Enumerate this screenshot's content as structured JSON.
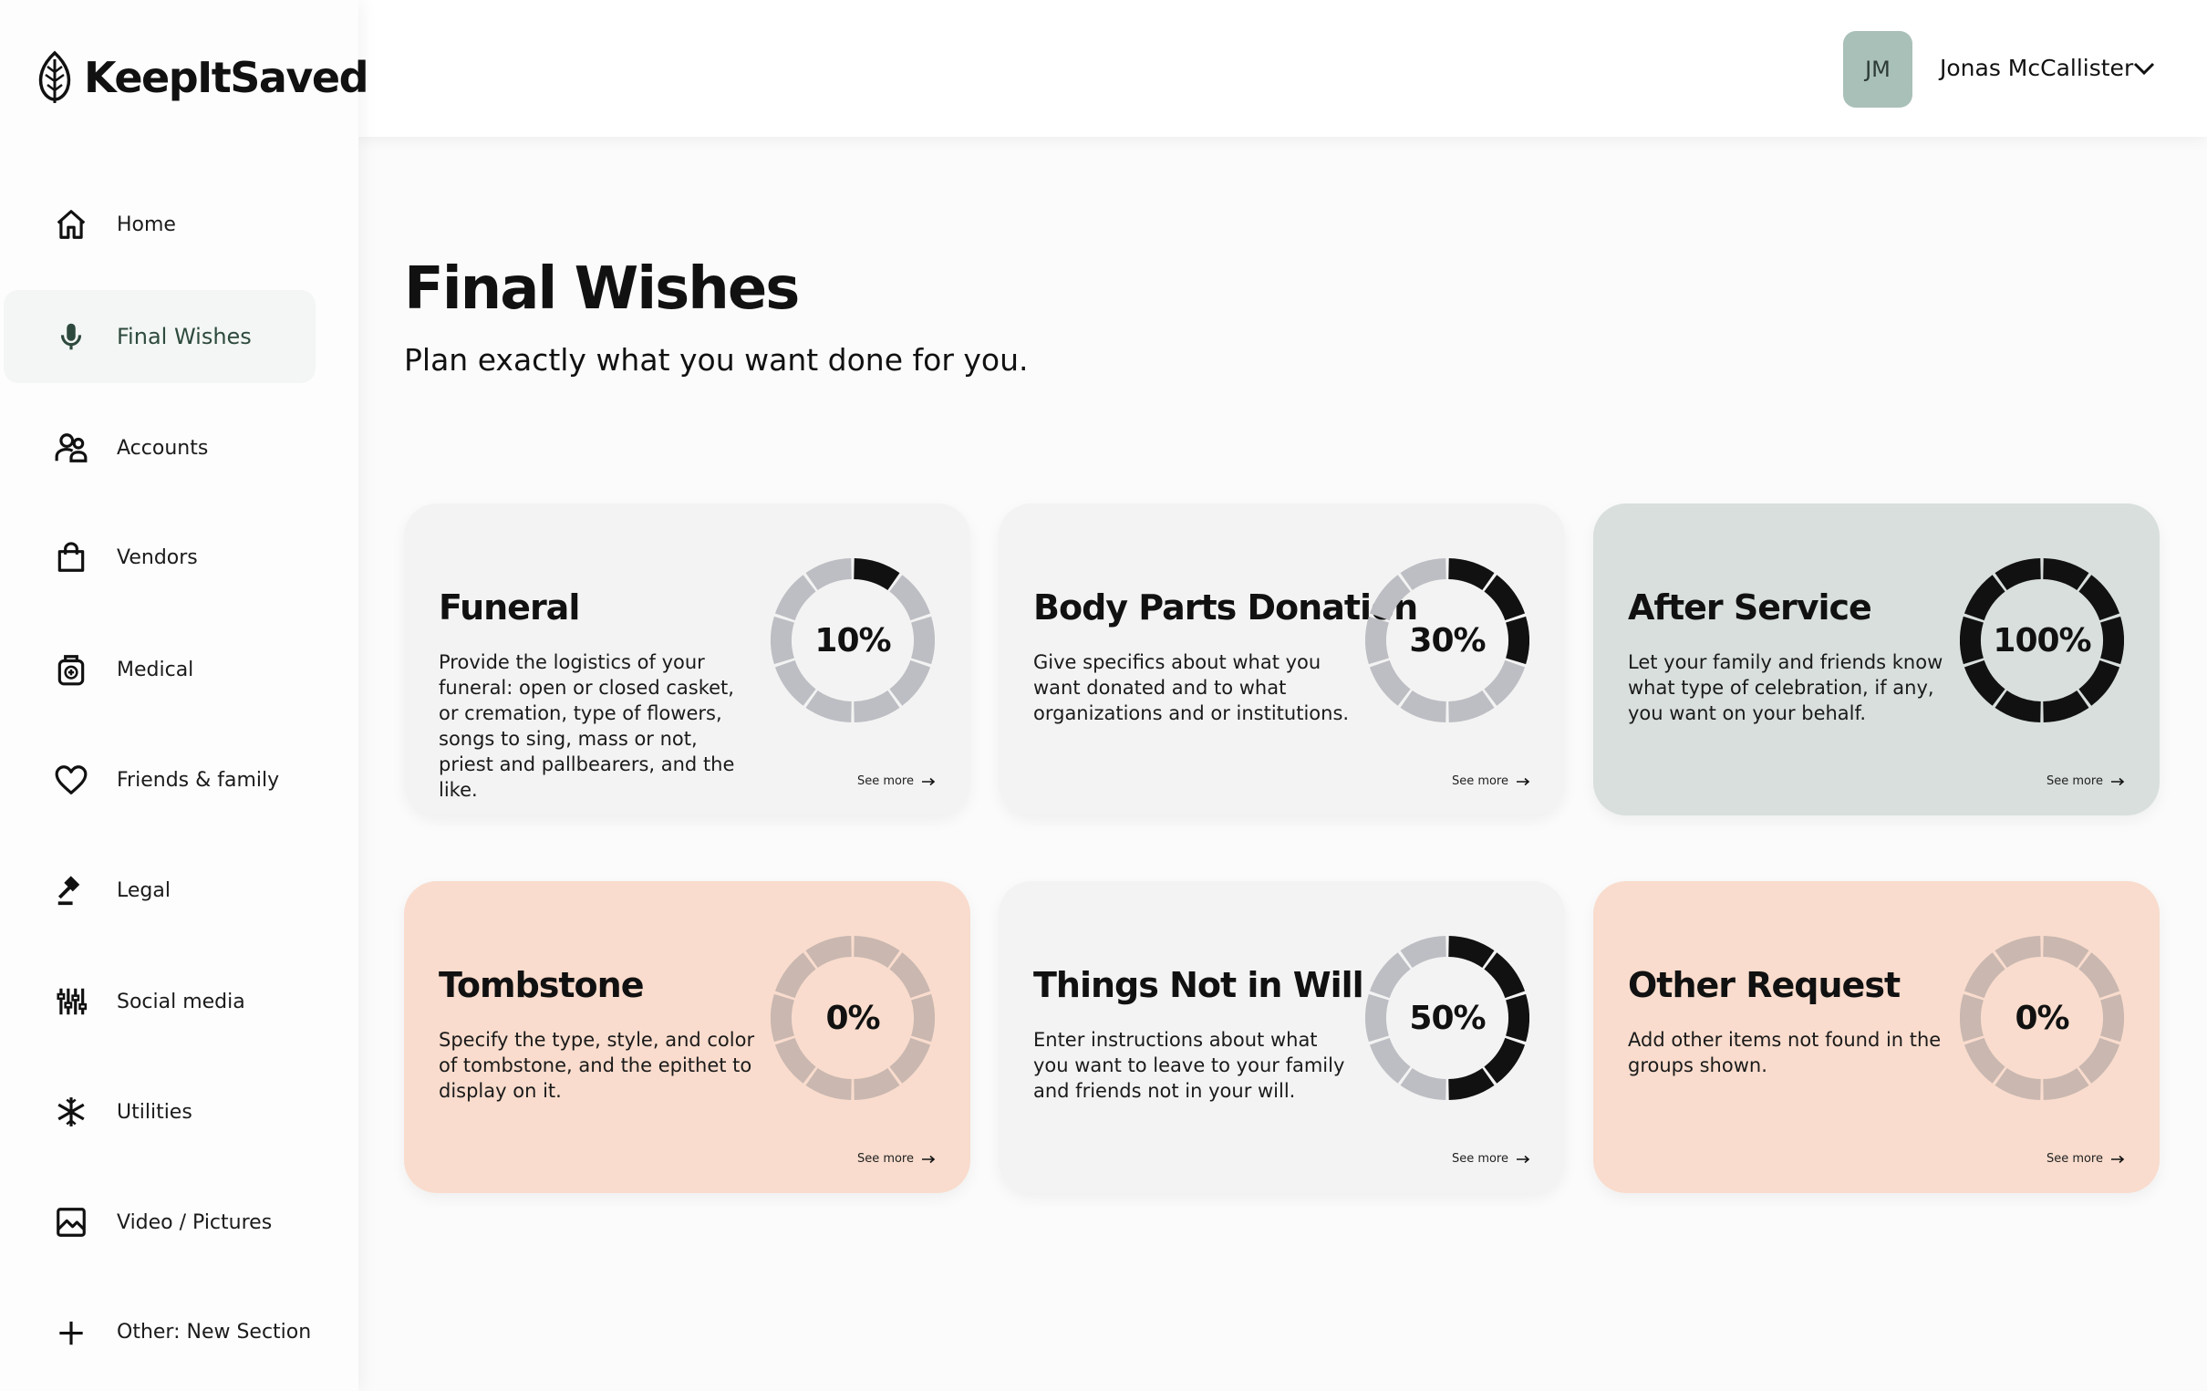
{
  "app": {
    "name": "KeepItSaved"
  },
  "sidebar": {
    "items": [
      {
        "label": "Home",
        "icon": "home-icon",
        "active": false
      },
      {
        "label": "Final Wishes",
        "icon": "microphone-icon",
        "active": true
      },
      {
        "label": "Accounts",
        "icon": "accounts-icon",
        "active": false
      },
      {
        "label": "Vendors",
        "icon": "shopping-bag-icon",
        "active": false
      },
      {
        "label": "Medical",
        "icon": "medical-icon",
        "active": false
      },
      {
        "label": "Friends & family",
        "icon": "heart-icon",
        "active": false
      },
      {
        "label": "Legal",
        "icon": "gavel-icon",
        "active": false
      },
      {
        "label": "Social media",
        "icon": "equalizer-icon",
        "active": false
      },
      {
        "label": "Utilities",
        "icon": "snowflake-icon",
        "active": false
      },
      {
        "label": "Video / Pictures",
        "icon": "image-icon",
        "active": false
      },
      {
        "label": "Other: New Section",
        "icon": "plus-icon",
        "active": false
      }
    ]
  },
  "user": {
    "initials": "JM",
    "name": "Jonas McCallister"
  },
  "header": {
    "title": "Final Wishes",
    "subtitle": "Plan exactly what you want done for you."
  },
  "cards": [
    {
      "title": "Funeral",
      "description": "Provide the logistics of your funeral: open or closed casket, or cremation, type of flowers, songs to sing, mass or not, priest and pallbearers, and the like.",
      "progress": 10,
      "progress_label": "10%",
      "see_more": "See more",
      "bg": "#f3f3f3",
      "track": "#bdbec3"
    },
    {
      "title": "Body Parts Donation",
      "description": "Give specifics about what you want donated and to what organizations and or institutions.",
      "progress": 30,
      "progress_label": "30%",
      "see_more": "See more",
      "bg": "#f3f3f3",
      "track": "#bdbec3"
    },
    {
      "title": "After Service",
      "description": "Let your family and friends know what type of celebration, if any, you want on your behalf.",
      "progress": 100,
      "progress_label": "100%",
      "see_more": "See more",
      "bg": "#d8dfdd",
      "track": "#bdbec3"
    },
    {
      "title": "Tombstone",
      "description": "Specify the type, style, and color of tombstone, and the epithet to display on it.",
      "progress": 0,
      "progress_label": "0%",
      "see_more": "See more",
      "bg": "#f9dccd",
      "track": "#c9b7b0"
    },
    {
      "title": "Things Not in Will",
      "description": "Enter instructions about what you want to leave to your family and friends not in your will.",
      "progress": 50,
      "progress_label": "50%",
      "see_more": "See more",
      "bg": "#f3f3f3",
      "track": "#bdbec3"
    },
    {
      "title": "Other Request",
      "description": "Add other items not found in the groups shown.",
      "progress": 0,
      "progress_label": "0%",
      "see_more": "See more",
      "bg": "#f9dccd",
      "track": "#c9b7b0"
    }
  ],
  "colors": {
    "accent": "#2e4a3e",
    "ring_fill": "#111111",
    "avatar_bg": "#a9c0b8"
  }
}
